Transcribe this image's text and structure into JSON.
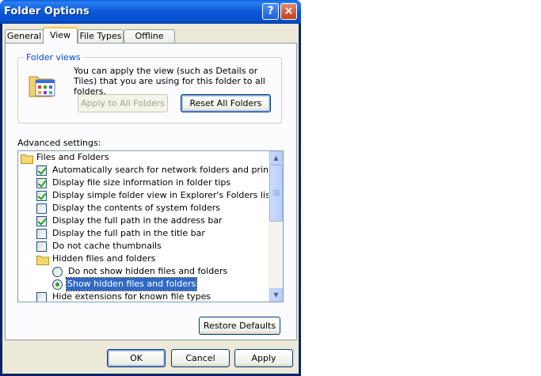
{
  "window": {
    "title": "Folder Options",
    "help_glyph": "?",
    "close_glyph": "×"
  },
  "tabs": [
    {
      "label": "General"
    },
    {
      "label": "View"
    },
    {
      "label": "File Types"
    },
    {
      "label": "Offline Files"
    }
  ],
  "folder_views": {
    "label": "Folder views",
    "description": "You can apply the view (such as Details or Tiles) that you are using for this folder to all folders.",
    "apply_all_label": "Apply to All Folders",
    "reset_all_label": "Reset All Folders"
  },
  "advanced": {
    "label": "Advanced settings:",
    "items": [
      {
        "type": "folder",
        "label": "Files and Folders",
        "indent": 0
      },
      {
        "type": "checkbox",
        "label": "Automatically search for network folders and printers",
        "checked": true,
        "indent": 1
      },
      {
        "type": "checkbox",
        "label": "Display file size information in folder tips",
        "checked": true,
        "indent": 1
      },
      {
        "type": "checkbox",
        "label": "Display simple folder view in Explorer's Folders list",
        "checked": true,
        "indent": 1
      },
      {
        "type": "checkbox",
        "label": "Display the contents of system folders",
        "checked": false,
        "indent": 1
      },
      {
        "type": "checkbox",
        "label": "Display the full path in the address bar",
        "checked": true,
        "indent": 1
      },
      {
        "type": "checkbox",
        "label": "Display the full path in the title bar",
        "checked": false,
        "indent": 1
      },
      {
        "type": "checkbox",
        "label": "Do not cache thumbnails",
        "checked": false,
        "indent": 1
      },
      {
        "type": "folder",
        "label": "Hidden files and folders",
        "indent": 1
      },
      {
        "type": "radio",
        "label": "Do not show hidden files and folders",
        "checked": false,
        "indent": 2
      },
      {
        "type": "radio",
        "label": "Show hidden files and folders",
        "checked": true,
        "indent": 2,
        "selected": true
      },
      {
        "type": "checkbox",
        "label": "Hide extensions for known file types",
        "checked": false,
        "indent": 1
      }
    ],
    "scroll_up_glyph": "▲",
    "scroll_down_glyph": "▼"
  },
  "buttons": {
    "restore_defaults": "Restore Defaults",
    "ok": "OK",
    "cancel": "Cancel",
    "apply": "Apply"
  },
  "colors": {
    "title_bar": "#0a5fe0",
    "dialog_face": "#ece9d8",
    "selection": "#316ac5",
    "check_mark": "#21a121"
  }
}
